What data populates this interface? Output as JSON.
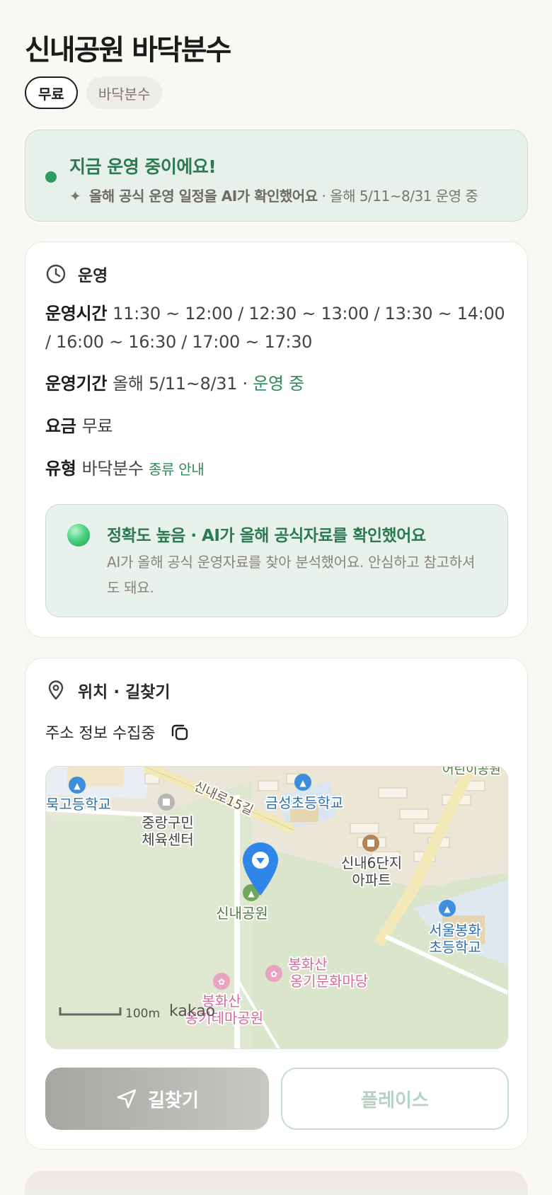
{
  "page": {
    "title": "신내공원 바닥분수",
    "chips": [
      "무료",
      "바닥분수"
    ]
  },
  "status": {
    "title": "지금 운영 중이에요!",
    "sub_bold": "올해 공식 운영 일정을 AI가 확인했어요",
    "sub_rest": " · 올해 5/11~8/31 운영 중"
  },
  "operation": {
    "heading": "운영",
    "hours_label": "운영시간",
    "hours_value": "11:30 ~ 12:00 / 12:30 ~ 13:00 / 13:30 ~ 14:00 / 16:00 ~ 16:30 / 17:00 ~ 17:30",
    "period_label": "운영기간",
    "period_value": "올해 5/11~8/31 · ",
    "period_status": "운영 중",
    "fee_label": "요금",
    "fee_value": "무료",
    "type_label": "유형",
    "type_value": "바닥분수",
    "type_link": "종류 안내",
    "accuracy_title": "정확도 높음 · AI가 올해 공식자료를 확인했어요",
    "accuracy_desc": "AI가 올해 공식 운영자료를 찾아 분석했어요. 안심하고 참고하셔도 돼요."
  },
  "location": {
    "heading": "위치 · 길찾기",
    "address": "주소 정보 수집중",
    "map": {
      "labels": {
        "school_left": "묵고등학교",
        "gym_line1": "중랑구민",
        "gym_line2": "체육센터",
        "road": "신내로15길",
        "school_top": "금성초등학교",
        "apt_line1": "신내6단지",
        "apt_line2": "아파트",
        "park": "신내공원",
        "school_right_line1": "서울봉화",
        "school_right_line2": "초등학교",
        "culture_line1": "봉화산",
        "culture_line2": "옹기문화마당",
        "theme_line1": "봉화산",
        "theme_line2": "옹기테마공원",
        "top_right": "어린이공원",
        "scale": "100m",
        "brand": "kakao"
      }
    },
    "route_button": "길찾기",
    "place_button": "플레이스"
  }
}
